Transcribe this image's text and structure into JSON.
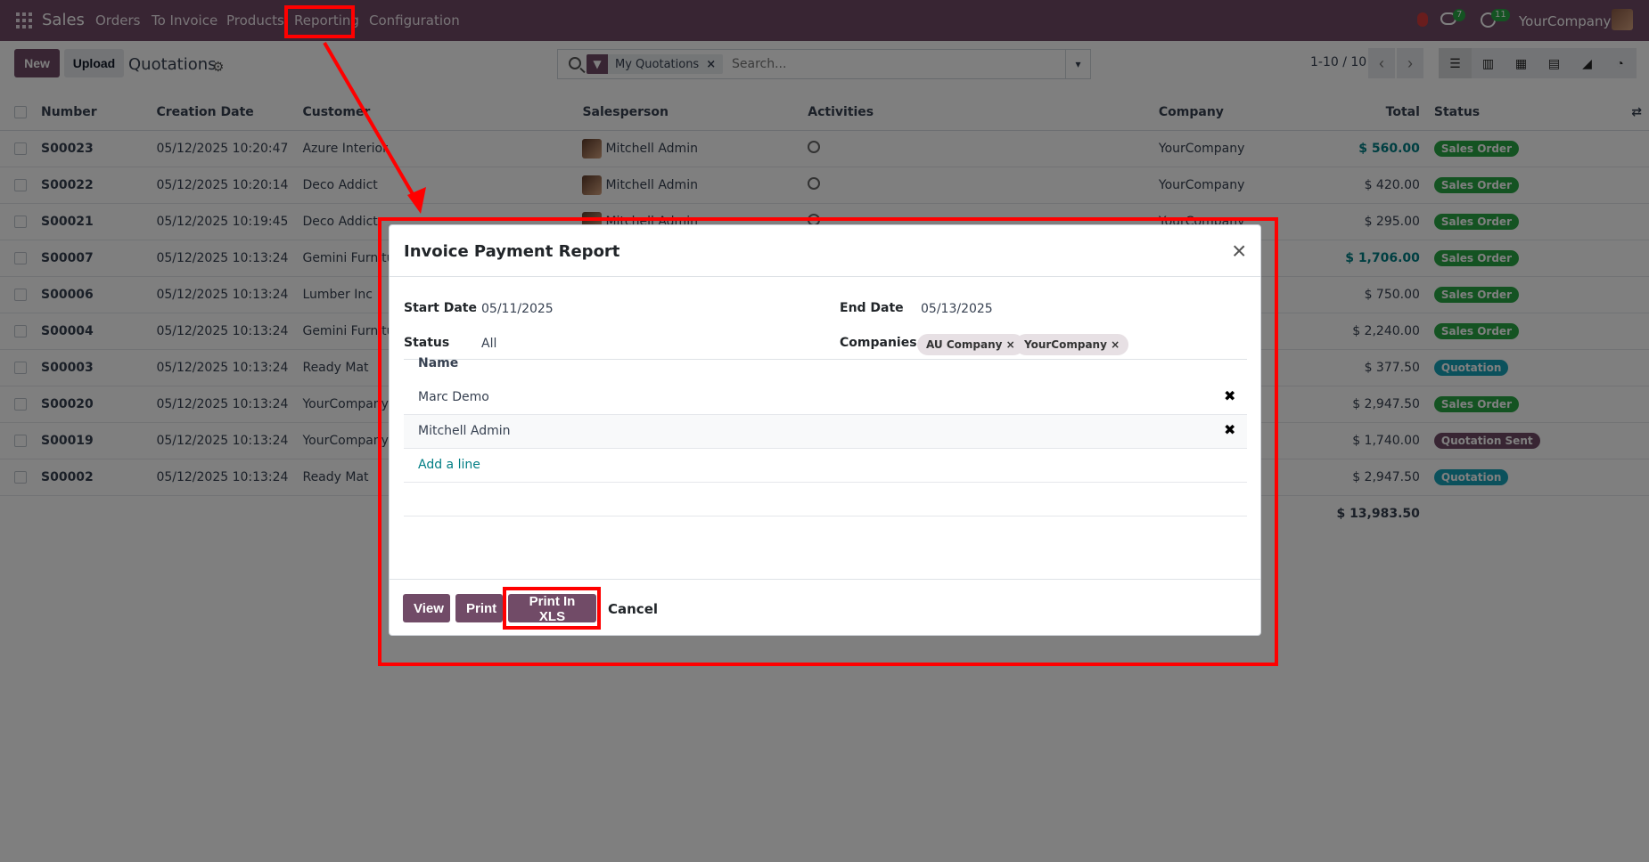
{
  "nav": {
    "brand": "Sales",
    "menus": [
      "Orders",
      "To Invoice",
      "Products",
      "Reporting",
      "Configuration"
    ],
    "messages_badge": "7",
    "activities_badge": "11",
    "company": "YourCompany"
  },
  "control": {
    "new": "New",
    "upload": "Upload",
    "title": "Quotations",
    "facet": "My Quotations",
    "search_placeholder": "Search...",
    "pager": "1-10 / 10"
  },
  "columns": [
    "Number",
    "Creation Date",
    "Customer",
    "Salesperson",
    "Activities",
    "Company",
    "Total",
    "Status"
  ],
  "rows": [
    {
      "number": "S00023",
      "date": "05/12/2025 10:20:47",
      "customer": "Azure Interior",
      "salesperson": "Mitchell Admin",
      "company": "YourCompany",
      "total": "$ 560.00",
      "status": "Sales Order",
      "highlight": true
    },
    {
      "number": "S00022",
      "date": "05/12/2025 10:20:14",
      "customer": "Deco Addict",
      "salesperson": "Mitchell Admin",
      "company": "YourCompany",
      "total": "$ 420.00",
      "status": "Sales Order",
      "highlight": false
    },
    {
      "number": "S00021",
      "date": "05/12/2025 10:19:45",
      "customer": "Deco Addict",
      "salesperson": "Mitchell Admin",
      "company": "YourCompany",
      "total": "$ 295.00",
      "status": "Sales Order",
      "highlight": false
    },
    {
      "number": "S00007",
      "date": "05/12/2025 10:13:24",
      "customer": "Gemini Furniture",
      "salesperson": "",
      "company": "",
      "total": "$ 1,706.00",
      "status": "Sales Order",
      "highlight": true
    },
    {
      "number": "S00006",
      "date": "05/12/2025 10:13:24",
      "customer": "Lumber Inc",
      "salesperson": "",
      "company": "",
      "total": "$ 750.00",
      "status": "Sales Order",
      "highlight": false
    },
    {
      "number": "S00004",
      "date": "05/12/2025 10:13:24",
      "customer": "Gemini Furniture",
      "salesperson": "",
      "company": "",
      "total": "$ 2,240.00",
      "status": "Sales Order",
      "highlight": false
    },
    {
      "number": "S00003",
      "date": "05/12/2025 10:13:24",
      "customer": "Ready Mat",
      "salesperson": "",
      "company": "",
      "total": "$ 377.50",
      "status": "Quotation",
      "highlight": false
    },
    {
      "number": "S00020",
      "date": "05/12/2025 10:13:24",
      "customer": "YourCompany, Jo",
      "salesperson": "",
      "company": "",
      "total": "$ 2,947.50",
      "status": "Sales Order",
      "highlight": false
    },
    {
      "number": "S00019",
      "date": "05/12/2025 10:13:24",
      "customer": "YourCompany, Jo",
      "salesperson": "",
      "company": "",
      "total": "$ 1,740.00",
      "status": "Quotation Sent",
      "highlight": false
    },
    {
      "number": "S00002",
      "date": "05/12/2025 10:13:24",
      "customer": "Ready Mat",
      "salesperson": "",
      "company": "",
      "total": "$ 2,947.50",
      "status": "Quotation",
      "highlight": false
    }
  ],
  "sum_total": "$ 13,983.50",
  "modal": {
    "title": "Invoice Payment Report",
    "start_label": "Start Date",
    "start": "05/11/2025",
    "end_label": "End Date",
    "end": "05/13/2025",
    "status_label": "Status",
    "status": "All",
    "companies_label": "Companies",
    "companies": [
      "AU Company",
      "YourCompany"
    ],
    "lines_header": "Name",
    "lines": [
      "Marc Demo",
      "Mitchell Admin"
    ],
    "add_line": "Add a line",
    "buttons": {
      "view": "View",
      "print": "Print",
      "xls": "Print In XLS",
      "cancel": "Cancel"
    }
  }
}
